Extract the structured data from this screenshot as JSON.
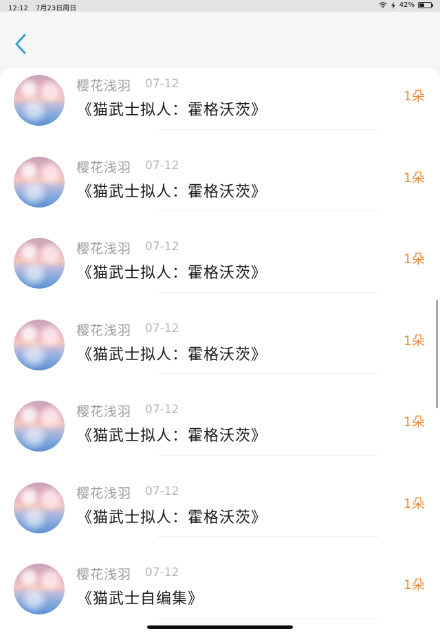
{
  "status_bar": {
    "time": "12:12",
    "date": "7月23日周日",
    "battery_percent": "42%",
    "battery_level": 0.42,
    "icons": [
      "wifi-icon",
      "charging-icon",
      "battery-icon"
    ]
  },
  "nav": {
    "back_icon": "chevron-left-icon",
    "accent_color": "#3a9bdc"
  },
  "list": {
    "items": [
      {
        "name": "樱花浅羽",
        "date": "07-12",
        "title": "《猫武士拟人：霍格沃茨》",
        "count": "1朵"
      },
      {
        "name": "樱花浅羽",
        "date": "07-12",
        "title": "《猫武士拟人：霍格沃茨》",
        "count": "1朵"
      },
      {
        "name": "樱花浅羽",
        "date": "07-12",
        "title": "《猫武士拟人：霍格沃茨》",
        "count": "1朵"
      },
      {
        "name": "樱花浅羽",
        "date": "07-12",
        "title": "《猫武士拟人：霍格沃茨》",
        "count": "1朵"
      },
      {
        "name": "樱花浅羽",
        "date": "07-12",
        "title": "《猫武士拟人：霍格沃茨》",
        "count": "1朵"
      },
      {
        "name": "樱花浅羽",
        "date": "07-12",
        "title": "《猫武士拟人：霍格沃茨》",
        "count": "1朵"
      },
      {
        "name": "樱花浅羽",
        "date": "07-12",
        "title": "《猫武士自编集》",
        "count": "1朵"
      }
    ],
    "count_color": "#ea8a3a"
  }
}
